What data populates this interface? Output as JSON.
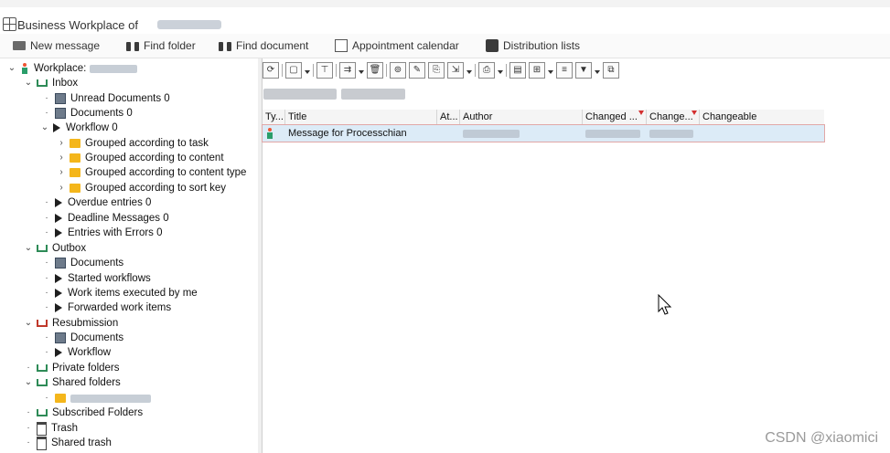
{
  "window": {
    "title": "Business Workplace of"
  },
  "toolbar": {
    "new_message": "New message",
    "find_folder": "Find folder",
    "find_document": "Find document",
    "appointment_calendar": "Appointment calendar",
    "distribution_lists": "Distribution lists"
  },
  "tree": {
    "workplace": "Workplace:",
    "inbox": "Inbox",
    "unread_documents": "Unread Documents 0",
    "documents": "Documents 0",
    "workflow": "Workflow 0",
    "grouped_task": "Grouped according to task",
    "grouped_content": "Grouped according to content",
    "grouped_content_type": "Grouped according to content type",
    "grouped_sort_key": "Grouped according to sort key",
    "overdue_entries": "Overdue entries 0",
    "deadline_messages": "Deadline Messages 0",
    "entries_with_errors": "Entries with Errors 0",
    "outbox": "Outbox",
    "outbox_documents": "Documents",
    "started_workflows": "Started workflows",
    "work_items_executed": "Work items executed by me",
    "forwarded_work_items": "Forwarded work items",
    "resubmission": "Resubmission",
    "resub_documents": "Documents",
    "resub_workflow": "Workflow",
    "private_folders": "Private folders",
    "shared_folders": "Shared folders",
    "subscribed_folders": "Subscribed Folders",
    "trash": "Trash",
    "shared_trash": "Shared trash"
  },
  "grid": {
    "columns": {
      "type": "Ty...",
      "title": "Title",
      "attachment": "At...",
      "author": "Author",
      "changed": "Changed ...",
      "changed2": "Change...",
      "changeable": "Changeable"
    },
    "rows": [
      {
        "title": "Message for Processchian"
      }
    ]
  },
  "watermark": "CSDN @xiaomici",
  "colors": {
    "accent_selection": "#dcebf7",
    "folder": "#f4b61b"
  },
  "icons": [
    "refresh-icon",
    "new-document-icon",
    "filter-icon",
    "delete-icon",
    "find-icon",
    "edit-icon",
    "print-icon",
    "sort-icon",
    "binoculars-icon"
  ]
}
